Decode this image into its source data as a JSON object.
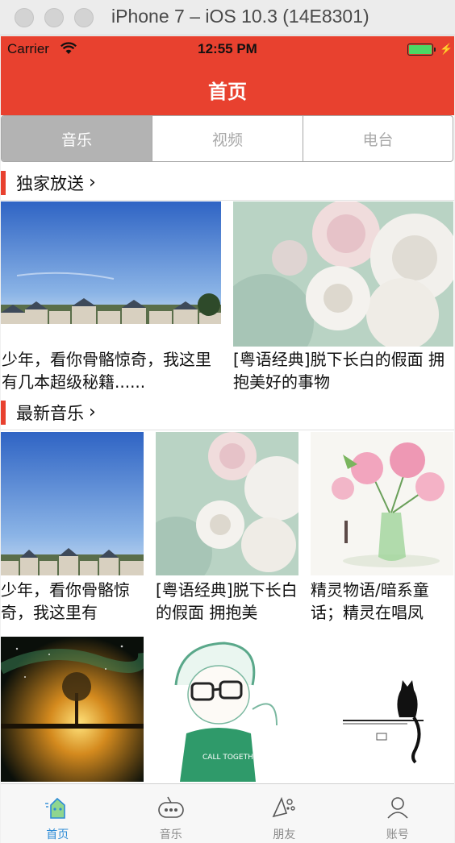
{
  "window": {
    "title": "iPhone 7 – iOS 10.3 (14E8301)"
  },
  "status_bar": {
    "carrier": "Carrier",
    "time": "12:55 PM",
    "battery_level": 1.0
  },
  "nav": {
    "title": "首页"
  },
  "segments": [
    {
      "label": "音乐",
      "selected": true
    },
    {
      "label": "视频",
      "selected": false
    },
    {
      "label": "电台",
      "selected": false
    }
  ],
  "sections": [
    {
      "title": "独家放送",
      "chevron": "›",
      "items": [
        {
          "image": "city-houses-sky",
          "caption": "少年，看你骨骼惊奇，我这里有几本超级秘籍......"
        },
        {
          "image": "white-roses",
          "caption": "[粤语经典]脱下长白的假面 拥抱美好的事物"
        }
      ]
    },
    {
      "title": "最新音乐",
      "chevron": "›",
      "items": [
        {
          "image": "city-houses-sky",
          "caption": "少年，看你骨骼惊奇，我这里有"
        },
        {
          "image": "white-roses",
          "caption": "[粤语经典]脱下长白的假面 拥抱美"
        },
        {
          "image": "pink-flowers-vase",
          "caption": "精灵物语/暗系童话；精灵在唱凤"
        },
        {
          "image": "glowing-tree-galaxy",
          "caption": ""
        },
        {
          "image": "boy-with-glasses-sketch",
          "caption": ""
        },
        {
          "image": "black-cat-on-ledge",
          "caption": ""
        }
      ]
    }
  ],
  "tabbar": [
    {
      "label": "首页",
      "icon": "home-icon",
      "active": true
    },
    {
      "label": "音乐",
      "icon": "radio-icon",
      "active": false
    },
    {
      "label": "朋友",
      "icon": "friends-icon",
      "active": false
    },
    {
      "label": "账号",
      "icon": "account-icon",
      "active": false
    }
  ],
  "colors": {
    "brand_red": "#e8412f",
    "tab_active": "#2d8bd6",
    "tab_inactive": "#8a8a8a"
  }
}
